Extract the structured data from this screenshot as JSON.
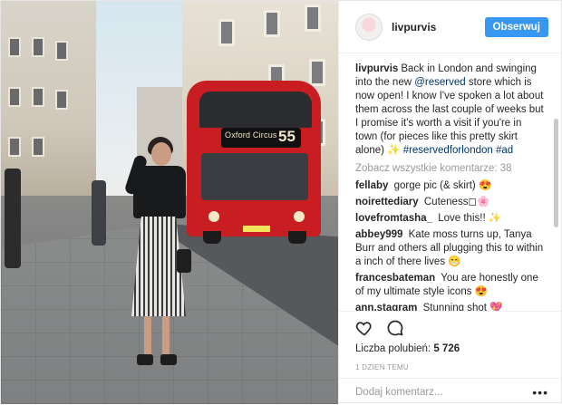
{
  "post": {
    "author": "livpurvis",
    "follow_label": "Obserwuj",
    "photo": {
      "bus_route": "Oxford Circus",
      "bus_number": "55"
    },
    "caption": {
      "username": "livpurvis",
      "text_1": "Back in London and swinging into the new ",
      "mention": "@reserved",
      "text_2": " store which is now open! I know I've spoken a lot about them across the last couple of weeks but I promise it's worth a visit if you're in town (for pieces like this pretty skirt alone) ✨",
      "hashtag_1": "#reservedforlondon",
      "hashtag_2": "#ad"
    },
    "view_all_comments": "Zobacz wszystkie komentarze: 38",
    "comments": [
      {
        "user": "fellaby",
        "text": "gorge pic (& skirt) 😍"
      },
      {
        "user": "noirettediary",
        "text": "Cuteness◻🌸"
      },
      {
        "user": "lovefromtasha_",
        "text": "Love this!! ✨"
      },
      {
        "user": "abbey999",
        "text": "Kate moss turns up, Tanya Burr and others all plugging this to within a inch of there lives 😁"
      },
      {
        "user": "francesbateman",
        "text": "You are honestly one of my ultimate style icons 😍"
      },
      {
        "user": "ann.stagram",
        "text": "Stunning shot 💖"
      }
    ],
    "icons": {
      "like": "heart-icon",
      "comment": "comment-icon",
      "more": "more-options-icon"
    },
    "likes_label": "Liczba polubień:",
    "likes_count": "5 726",
    "timestamp": "1 DZIEŃ TEMU",
    "comment_placeholder": "Dodaj komentarz...",
    "more_label": "•••",
    "colors": {
      "follow_button": "#3897f0",
      "link": "#003569",
      "muted_text": "#999999"
    }
  }
}
